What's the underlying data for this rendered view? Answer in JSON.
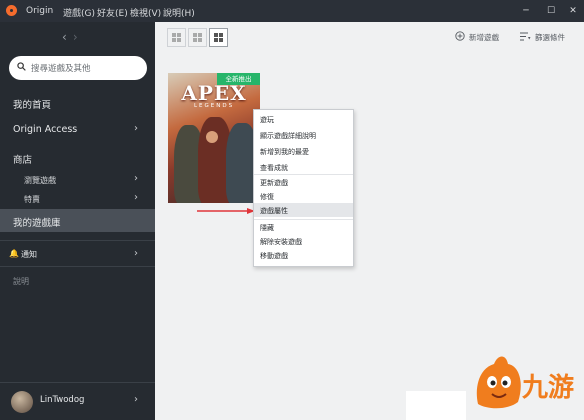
{
  "titlebar": {
    "menu": [
      "Origin",
      "遊戲(G)",
      "好友(E)",
      "檢視(V)",
      "說明(H)"
    ],
    "controls": [
      "minimize",
      "maximize",
      "close"
    ]
  },
  "sidebar": {
    "search_placeholder": "搜尋遊戲及其他",
    "my_home": "我的首頁",
    "origin_access": "Origin Access",
    "store": "商店",
    "browse_games": "瀏覽遊戲",
    "deals": "特賣",
    "my_library": "我的遊戲庫",
    "notifications": "通知",
    "help": "說明",
    "username": "LinTwodog"
  },
  "toolbar": {
    "add_game": "新增遊戲",
    "filter": "篩選條件"
  },
  "game": {
    "title": "APEX",
    "subtitle": "LEGENDS",
    "badge": "全新推出"
  },
  "context_menu": {
    "items": [
      "遊玩",
      "顯示遊戲詳細說明",
      "新增到我的最愛",
      "查看成就",
      "更新遊戲",
      "修復",
      "遊戲屬性",
      "隱藏",
      "解除安裝遊戲",
      "移動遊戲"
    ],
    "highlighted_index": 6
  },
  "watermark": "九游",
  "colors": {
    "sidebar_bg": "#262b31",
    "active_item": "#4a5058",
    "badge_green": "#27b56a",
    "accent_orange": "#f56c2d",
    "arrow_red": "#e0353a"
  }
}
